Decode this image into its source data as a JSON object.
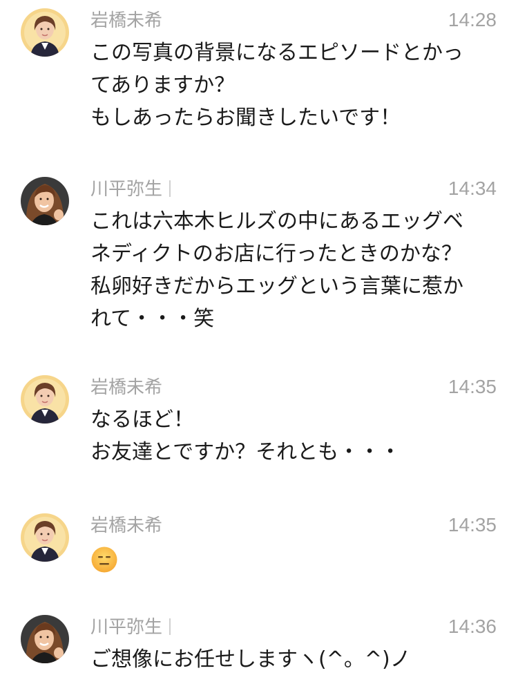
{
  "messages": [
    {
      "sender": "岩橋未希",
      "time": "14:28",
      "lines": [
        "この写真の背景になるエピソードとかっ",
        "てありますか？",
        "もしあったらお聞きしたいです！"
      ]
    },
    {
      "sender": "川平弥生",
      "time": "14:34",
      "lines": [
        "これは六本木ヒルズの中にあるエッグベ",
        "ネディクトのお店に行ったときのかな？",
        "私卵好きだからエッグという言葉に惹か",
        "れて・・・笑"
      ]
    },
    {
      "sender": "岩橋未希",
      "time": "14:35",
      "lines": [
        "なるほど！",
        "お友達とですか？それとも・・・"
      ]
    },
    {
      "sender": "岩橋未希",
      "time": "14:35",
      "emoji": "expressionless-face-emoji"
    },
    {
      "sender": "川平弥生",
      "time": "14:36",
      "lines": [
        "ご想像にお任せしますヽ(^。^)ノ"
      ]
    }
  ],
  "colors": {
    "meta_text": "#a3a3a3",
    "body_text": "#1a1a1a",
    "background": "#ffffff"
  }
}
